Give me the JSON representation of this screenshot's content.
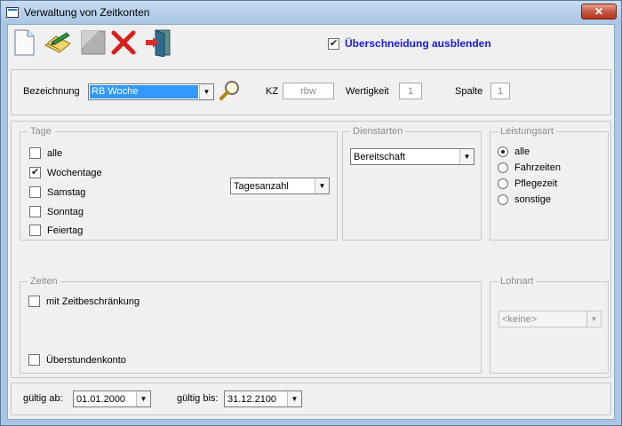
{
  "window": {
    "title": "Verwaltung von Zeitkonten",
    "close_label": "✕"
  },
  "toolbar": {
    "icons": [
      "new-document-icon",
      "edit-icon",
      "save-icon",
      "delete-icon",
      "exit-icon"
    ],
    "overlap_checkbox": {
      "label": "Überschneidung ausblenden",
      "checked": true
    }
  },
  "header": {
    "bezeichnung_label": "Bezeichnung",
    "bezeichnung_value": "RB Woche",
    "kz_label": "KZ",
    "kz_value": "rbw",
    "wertigkeit_label": "Wertigkeit",
    "wertigkeit_value": "1",
    "spalte_label": "Spalte",
    "spalte_value": "1"
  },
  "tage": {
    "title": "Tage",
    "items": [
      {
        "label": "alle",
        "checked": false
      },
      {
        "label": "Wochentage",
        "checked": true
      },
      {
        "label": "Samstag",
        "checked": false
      },
      {
        "label": "Sonntag",
        "checked": false
      },
      {
        "label": "Feiertag",
        "checked": false
      }
    ],
    "select_value": "Tagesanzahl"
  },
  "dienstarten": {
    "title": "Dienstarten",
    "select_value": "Bereitschaft"
  },
  "leistungsart": {
    "title": "Leistungsart",
    "options": [
      "alle",
      "Fahrzeiten",
      "Pflegezeit",
      "sonstige"
    ],
    "selected": 0
  },
  "zeiten": {
    "title": "Zeiten",
    "zeitbeschraenkung_label": "mit Zeitbeschränkung",
    "ueberstunden_label": "Überstundenkonto"
  },
  "lohnart": {
    "title": "Lohnart",
    "select_value": "<keine>"
  },
  "validity": {
    "from_label": "gültig ab:",
    "from_value": "01.01.2000",
    "to_label": "gültig bis:",
    "to_value": "31.12.2100"
  }
}
